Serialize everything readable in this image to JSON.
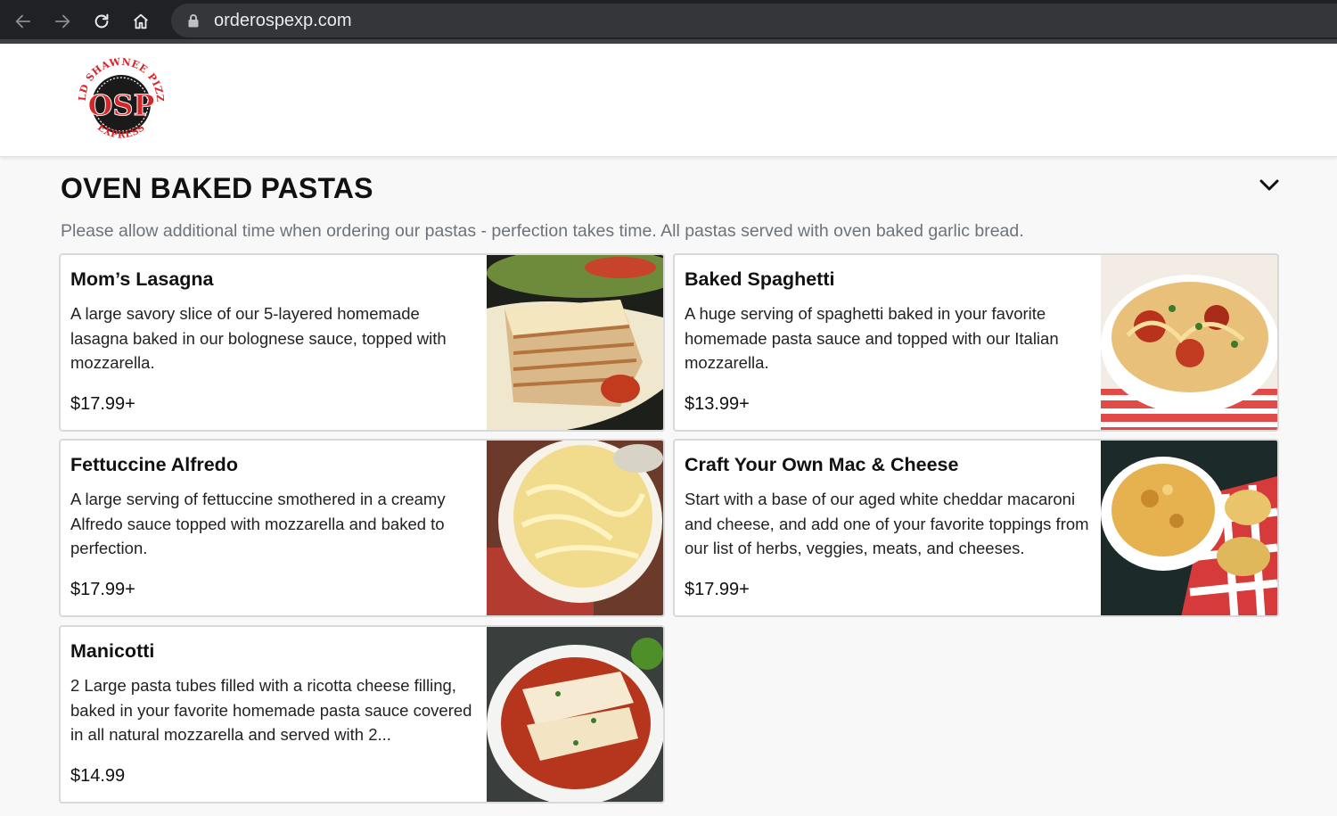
{
  "browser": {
    "url": "orderospexp.com",
    "icons": [
      "back-arrow-icon",
      "forward-arrow-icon",
      "reload-icon",
      "home-icon",
      "lock-icon"
    ]
  },
  "header": {
    "logo": {
      "top_text": "OLD SHAWNEE PIZZA",
      "center_text": "OSP",
      "bottom_text": "EXPRESS"
    }
  },
  "section": {
    "title": "OVEN BAKED PASTAS",
    "note": "Please allow additional time when ordering our pastas - perfection takes time. All pastas served with oven baked garlic bread.",
    "collapse_icon": "chevron-down-icon"
  },
  "items": [
    {
      "name": "Mom’s Lasagna",
      "description": "A large savory slice of our 5-layered homemade lasagna baked in our bolognese sauce, topped with mozzarella.",
      "price": "$17.99+"
    },
    {
      "name": "Baked Spaghetti",
      "description": "A huge serving of spaghetti baked in your favorite homemade pasta sauce and topped with our Italian mozzarella.",
      "price": "$13.99+"
    },
    {
      "name": "Fettuccine Alfredo",
      "description": "A large serving of fettuccine smothered in a creamy Alfredo sauce topped with mozzarella and baked to perfection.",
      "price": "$17.99+"
    },
    {
      "name": "Craft Your Own Mac & Cheese",
      "description": "Start with a base of our aged white cheddar macaroni and cheese, and add one of your favorite toppings from our list of herbs, veggies, meats, and cheeses.",
      "price": "$17.99+"
    },
    {
      "name": "Manicotti",
      "description": "2 Large pasta tubes filled with a ricotta cheese filling, baked in your favorite homemade pasta sauce covered in all natural mozzarella and served with 2...",
      "price": "$14.99"
    }
  ],
  "colors": {
    "chrome_bg": "#202124",
    "urlbar_bg": "#35363a",
    "logo_red": "#d7262a",
    "page_bg": "#f8f8f8",
    "note_gray": "#6c737a"
  }
}
